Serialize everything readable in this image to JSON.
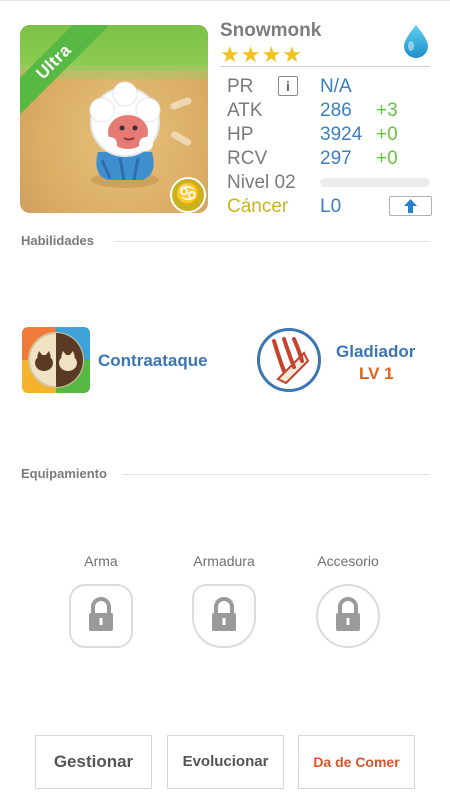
{
  "unit": {
    "name": "Snowmonk",
    "stars": "★★★★",
    "badge": "Ultra",
    "zodiac_symbol": "♋",
    "element_icon": "water-drop-icon"
  },
  "stats": {
    "pr_label": "PR",
    "pr_info": "i",
    "pr_value": "N/A",
    "atk_label": "ATK",
    "atk_value": "286",
    "atk_bonus": "+3",
    "hp_label": "HP",
    "hp_value": "3924",
    "hp_bonus": "+0",
    "rcv_label": "RCV",
    "rcv_value": "297",
    "rcv_bonus": "+0",
    "level_label": "Nivel 02",
    "zodiac_label": "Cáncer",
    "rank_value": "L0",
    "upgrade_icon": "up-arrow-icon"
  },
  "abilities": {
    "section_title": "Habilidades",
    "skills": [
      {
        "name": "Contraataque",
        "icon": "pigs-icon"
      },
      {
        "name": "Gladiador",
        "level": "LV 1",
        "icon": "claw-icon"
      }
    ]
  },
  "equipment": {
    "section_title": "Equipamiento",
    "slots": [
      {
        "label": "Arma",
        "icon": "lock-icon"
      },
      {
        "label": "Armadura",
        "icon": "lock-icon"
      },
      {
        "label": "Accesorio",
        "icon": "lock-icon"
      }
    ]
  },
  "actions": {
    "manage": "Gestionar",
    "evolve": "Evolucionar",
    "feed": "Da de Comer"
  },
  "colors": {
    "accent_blue": "#3a76b4",
    "bonus_green": "#6abf45",
    "level_orange": "#e2631e",
    "zodiac_gold": "#c8b51c",
    "star_gold": "#f2c21c",
    "ribbon_green": "#58b844"
  }
}
